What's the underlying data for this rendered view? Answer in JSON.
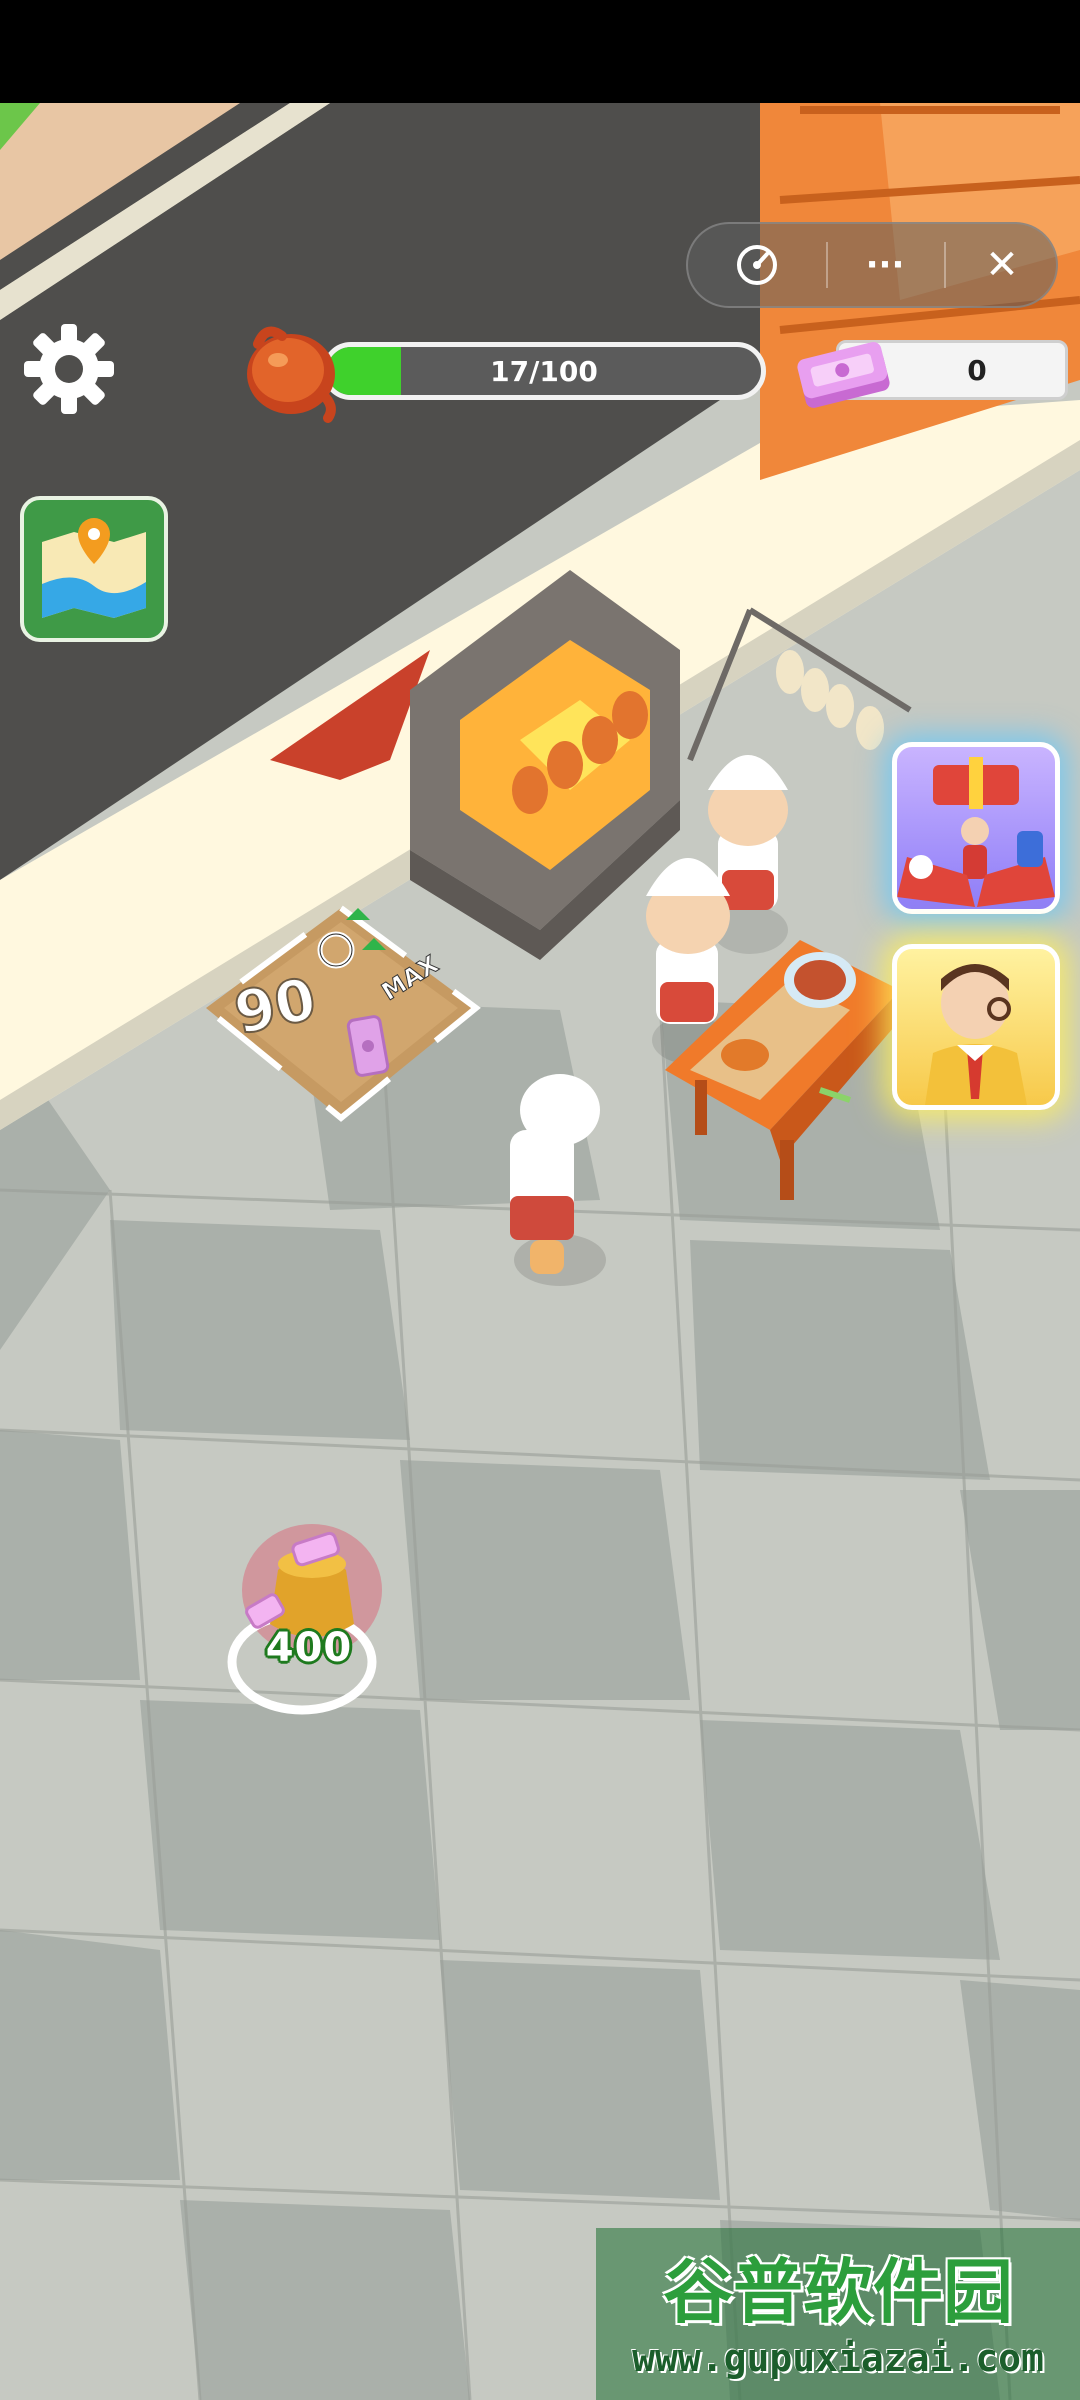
{
  "hud": {
    "progress": {
      "text": "17/100",
      "current": 17,
      "max": 100,
      "fill_color": "#3fd12c",
      "track_color": "#5b5b5b",
      "icon": "roast-duck-icon"
    },
    "cash": {
      "value": "0",
      "icon": "cash-stack-icon"
    },
    "settings_icon": "gear-icon",
    "map_icon": "map-pin-icon"
  },
  "miniprogram_capsule": {
    "icons": [
      "game-controller-icon",
      "more-dots-icon",
      "close-icon"
    ],
    "more_label": "···",
    "close_label": "✕"
  },
  "upgrade_pad": {
    "price": "90",
    "badge": "MAX",
    "icons": [
      "stopwatch-icon",
      "green-arrow-up-icon",
      "cash-icon"
    ]
  },
  "coin_bag": {
    "price": "400",
    "icon": "money-bag-icon"
  },
  "side_buttons": {
    "gift_icon": "gift-box-icon",
    "manager_icon": "manager-avatar-icon"
  },
  "watermark": {
    "logo_text": "谷普软件园",
    "url": "www.gupuxiazai.com"
  },
  "colors": {
    "street": "#4f4e4c",
    "floor_light": "#c9ccc4",
    "floor_dark": "#aeb3ad",
    "wall_cream": "#fff8df",
    "shop_orange": "#f0873a"
  }
}
